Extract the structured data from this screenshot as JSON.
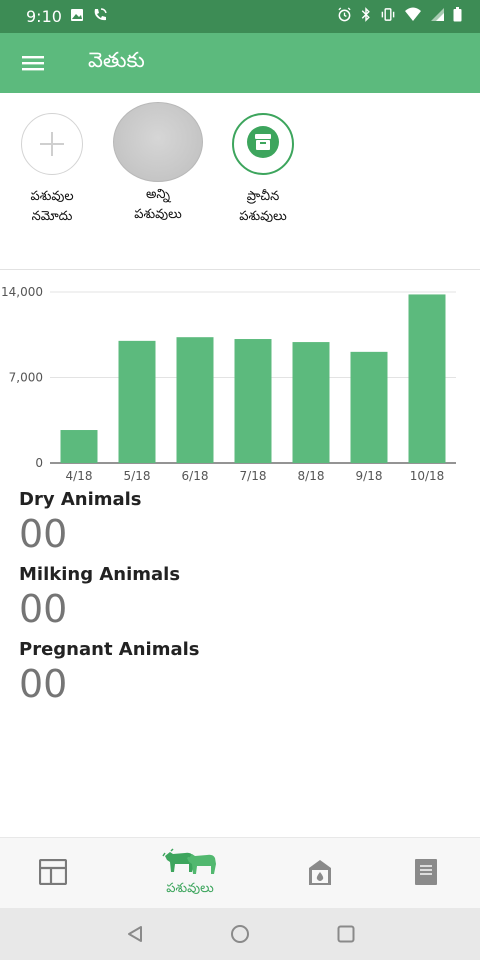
{
  "status_bar": {
    "time": "9:10",
    "left_icons": [
      "image-icon",
      "wifi-call-icon"
    ],
    "right_icons": [
      "alarm-icon",
      "bluetooth-icon",
      "vibrate-icon",
      "wifi-icon",
      "signal-icon",
      "battery-icon"
    ]
  },
  "app_bar": {
    "title": "వెతుకు",
    "menu_icon": "hamburger-menu-icon"
  },
  "shortcuts": [
    {
      "label_line1": "పశువుల",
      "label_line2": "నమోదు",
      "icon": "plus-icon"
    },
    {
      "label_line1": "అన్ని",
      "label_line2": "పశువులు",
      "icon": "all-animals-avatar"
    },
    {
      "label_line1": "ప్రాచీన",
      "label_line2": "పశువులు",
      "icon": "archive-icon"
    }
  ],
  "chart_data": {
    "type": "bar",
    "categories": [
      "4/18",
      "5/18",
      "6/18",
      "7/18",
      "8/18",
      "9/18",
      "10/18"
    ],
    "values": [
      2700,
      10000,
      10300,
      10150,
      9900,
      9100,
      13800
    ],
    "y_tick_labels": [
      "0",
      "7,000",
      "14,000"
    ],
    "y_ticks": [
      0,
      7000,
      14000
    ],
    "ylim": [
      0,
      14000
    ],
    "grid": true,
    "bar_color": "#5cba7d"
  },
  "stats": [
    {
      "label": "Dry Animals",
      "value": "00"
    },
    {
      "label": "Milking Animals",
      "value": "00"
    },
    {
      "label": "Pregnant Animals",
      "value": "00"
    }
  ],
  "bottom_nav": {
    "items": [
      {
        "icon": "dashboard-icon",
        "label": ""
      },
      {
        "icon": "cattle-icon",
        "label": "పశువులు",
        "active": true
      },
      {
        "icon": "dairy-shed-icon",
        "label": ""
      },
      {
        "icon": "notebook-icon",
        "label": ""
      }
    ],
    "active_color": "#3da55d"
  },
  "system_nav": [
    "back-icon",
    "home-icon",
    "recents-icon"
  ],
  "colors": {
    "status_bar": "#3d8c55",
    "app_bar": "#5cba7d",
    "accent": "#3da55d"
  }
}
